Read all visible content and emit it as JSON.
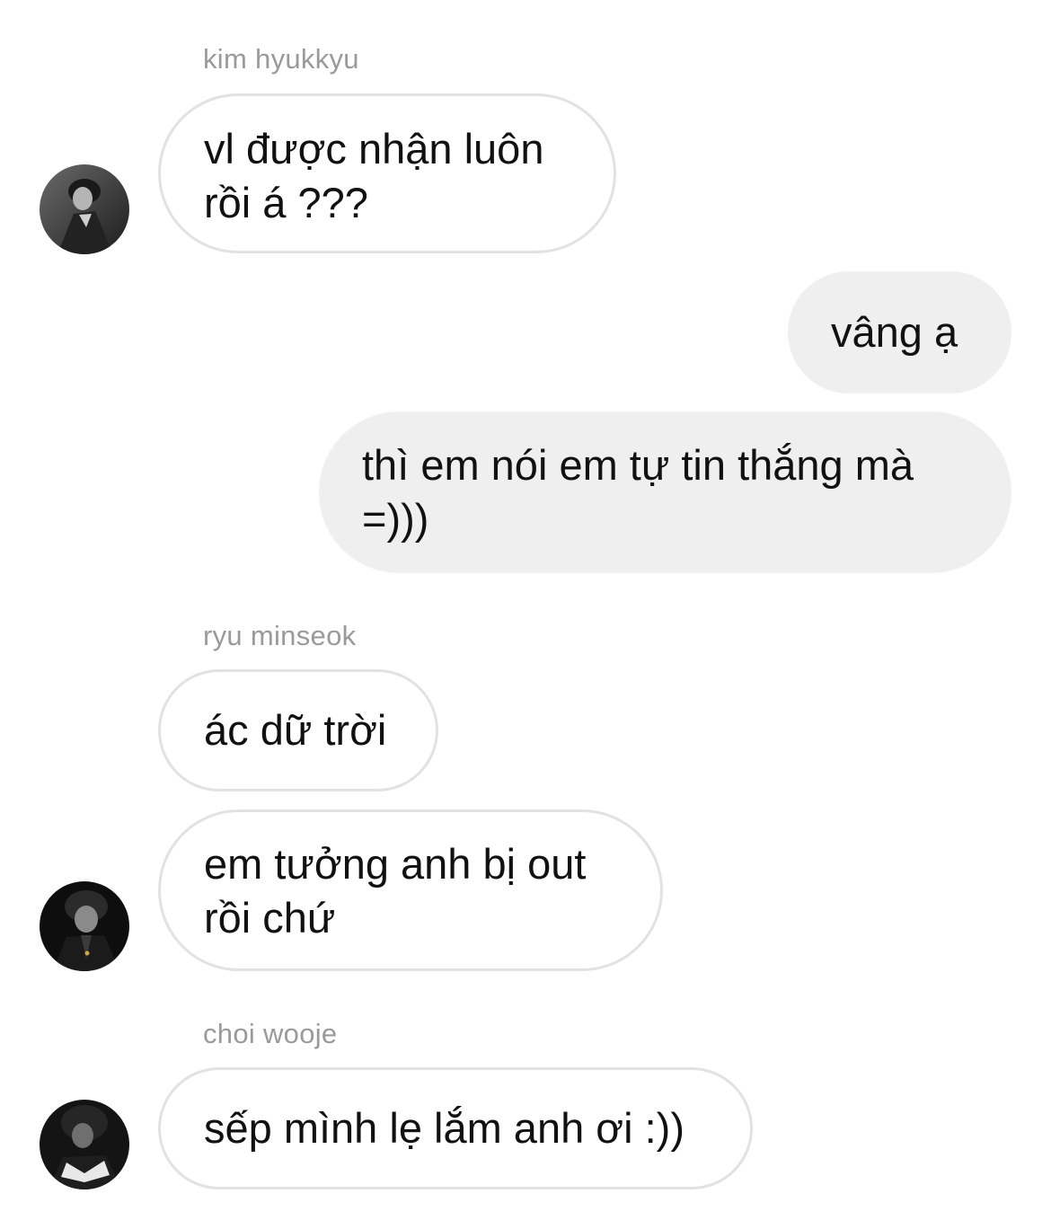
{
  "messages": [
    {
      "sender": "kim hyukkyu",
      "lines": [
        "vl được nhận luôn",
        "rồi á ???"
      ]
    },
    {
      "lines": [
        "vâng ạ"
      ]
    },
    {
      "lines": [
        "thì em nói em tự tin thắng mà",
        "=)))"
      ]
    },
    {
      "sender": "ryu minseok",
      "lines": [
        "ác dữ trời"
      ]
    },
    {
      "lines": [
        "em tưởng anh bị out",
        "rồi chứ"
      ]
    },
    {
      "sender": "choi wooje",
      "lines": [
        "sếp mình lẹ lắm anh ơi :))"
      ]
    }
  ],
  "avatars": [
    "profile-photo-icon",
    "profile-photo-icon",
    "profile-photo-icon"
  ],
  "colors": {
    "incoming_bubble_bg": "#ffffff",
    "incoming_bubble_border": "#e2e2e2",
    "outgoing_bubble_bg": "#efefef",
    "sender_name": "#9a9a9a",
    "text": "#111111"
  }
}
